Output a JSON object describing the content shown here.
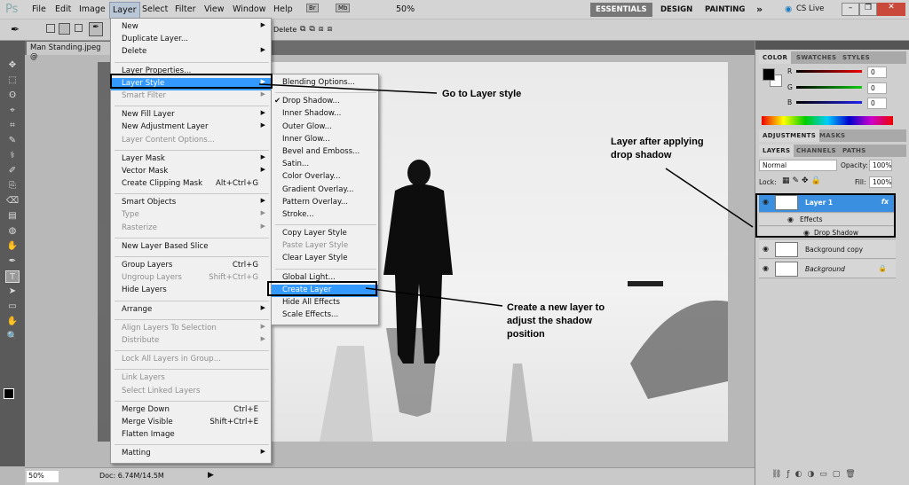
{
  "app": {
    "logo": "Ps",
    "menus": [
      "File",
      "Edit",
      "Image",
      "Layer",
      "Select",
      "Filter",
      "View",
      "Window",
      "Help"
    ],
    "active_menu": "Layer",
    "bridge": "Br",
    "minibridge": "Mb",
    "zoom": "50%"
  },
  "workspaces": {
    "items": [
      "ESSENTIALS",
      "DESIGN",
      "PAINTING"
    ],
    "more": "»",
    "cslive": "CS Live"
  },
  "options": {
    "delete_label": "Delete"
  },
  "document": {
    "tab": "Man Standing.jpeg @"
  },
  "status": {
    "zoom": "50%",
    "doc": "Doc: 6.74M/14.5M"
  },
  "layer_menu": [
    {
      "label": "New",
      "arrow": true
    },
    {
      "label": "Duplicate Layer..."
    },
    {
      "label": "Delete",
      "arrow": true
    },
    {
      "sep": true
    },
    {
      "label": "Layer Properties..."
    },
    {
      "label": "Layer Style",
      "arrow": true,
      "hl": true
    },
    {
      "label": "Smart Filter",
      "arrow": true,
      "dis": true
    },
    {
      "sep": true
    },
    {
      "label": "New Fill Layer",
      "arrow": true
    },
    {
      "label": "New Adjustment Layer",
      "arrow": true
    },
    {
      "label": "Layer Content Options...",
      "dis": true
    },
    {
      "sep": true
    },
    {
      "label": "Layer Mask",
      "arrow": true
    },
    {
      "label": "Vector Mask",
      "arrow": true
    },
    {
      "label": "Create Clipping Mask",
      "shortcut": "Alt+Ctrl+G"
    },
    {
      "sep": true
    },
    {
      "label": "Smart Objects",
      "arrow": true
    },
    {
      "label": "Type",
      "arrow": true,
      "dis": true
    },
    {
      "label": "Rasterize",
      "arrow": true,
      "dis": true
    },
    {
      "sep": true
    },
    {
      "label": "New Layer Based Slice"
    },
    {
      "sep": true
    },
    {
      "label": "Group Layers",
      "shortcut": "Ctrl+G"
    },
    {
      "label": "Ungroup Layers",
      "shortcut": "Shift+Ctrl+G",
      "dis": true
    },
    {
      "label": "Hide Layers"
    },
    {
      "sep": true
    },
    {
      "label": "Arrange",
      "arrow": true
    },
    {
      "sep": true
    },
    {
      "label": "Align Layers To Selection",
      "arrow": true,
      "dis": true
    },
    {
      "label": "Distribute",
      "arrow": true,
      "dis": true
    },
    {
      "sep": true
    },
    {
      "label": "Lock All Layers in Group...",
      "dis": true
    },
    {
      "sep": true
    },
    {
      "label": "Link Layers",
      "dis": true
    },
    {
      "label": "Select Linked Layers",
      "dis": true
    },
    {
      "sep": true
    },
    {
      "label": "Merge Down",
      "shortcut": "Ctrl+E"
    },
    {
      "label": "Merge Visible",
      "shortcut": "Shift+Ctrl+E"
    },
    {
      "label": "Flatten Image"
    },
    {
      "sep": true
    },
    {
      "label": "Matting",
      "arrow": true
    }
  ],
  "style_menu": [
    {
      "label": "Blending Options..."
    },
    {
      "sep": true
    },
    {
      "label": "Drop Shadow...",
      "check": true
    },
    {
      "label": "Inner Shadow..."
    },
    {
      "label": "Outer Glow..."
    },
    {
      "label": "Inner Glow..."
    },
    {
      "label": "Bevel and Emboss..."
    },
    {
      "label": "Satin..."
    },
    {
      "label": "Color Overlay..."
    },
    {
      "label": "Gradient Overlay..."
    },
    {
      "label": "Pattern Overlay..."
    },
    {
      "label": "Stroke..."
    },
    {
      "sep": true
    },
    {
      "label": "Copy Layer Style"
    },
    {
      "label": "Paste Layer Style",
      "dis": true
    },
    {
      "label": "Clear Layer Style"
    },
    {
      "sep": true
    },
    {
      "label": "Global Light..."
    },
    {
      "label": "Create Layer",
      "hl": true
    },
    {
      "label": "Hide All Effects"
    },
    {
      "label": "Scale Effects..."
    }
  ],
  "annotations": {
    "a1": "Go to Layer style",
    "a2": "Layer after applying drop shadow",
    "a3": "Create a new layer to adjust the shadow position"
  },
  "color_panel": {
    "tabs": [
      "COLOR",
      "SWATCHES",
      "STYLES"
    ],
    "r_label": "R",
    "g_label": "G",
    "b_label": "B",
    "r": "0",
    "g": "0",
    "b": "0"
  },
  "adj_panel": {
    "tabs": [
      "ADJUSTMENTS",
      "MASKS"
    ]
  },
  "layers_panel": {
    "tabs": [
      "LAYERS",
      "CHANNELS",
      "PATHS"
    ],
    "blend": "Normal",
    "opacity_label": "Opacity:",
    "opacity": "100%",
    "lock_label": "Lock:",
    "fill_label": "Fill:",
    "fill": "100%",
    "layers": [
      {
        "name": "Layer 1",
        "fx": "fx",
        "selected": true
      },
      {
        "name": "Effects",
        "sub": 1
      },
      {
        "name": "Drop Shadow",
        "sub": 2
      },
      {
        "name": "Background copy"
      },
      {
        "name": "Background",
        "italic": true,
        "locked": true
      }
    ]
  },
  "colors": {
    "highlight": "#3399ff",
    "panel": "#cfcfcf"
  }
}
